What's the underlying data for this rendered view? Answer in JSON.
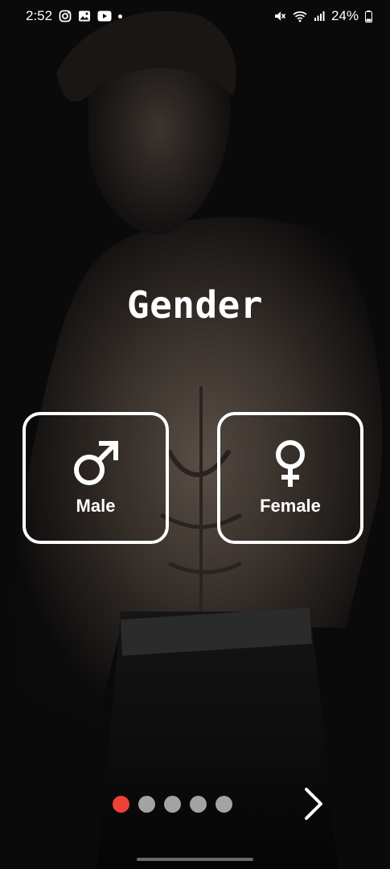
{
  "status_bar": {
    "time": "2:52",
    "battery": "24%",
    "left_icons": [
      "instagram-icon",
      "gallery-icon",
      "youtube-icon",
      "notification-dot"
    ],
    "right_icons": [
      "mute-icon",
      "wifi-icon",
      "signal-icon",
      "battery-icon"
    ]
  },
  "screen": {
    "title": "Gender"
  },
  "options": [
    {
      "label": "Male",
      "icon": "male-symbol-icon"
    },
    {
      "label": "Female",
      "icon": "female-symbol-icon"
    }
  ],
  "pager": {
    "total": 5,
    "current": 1,
    "active_color": "#ef4237",
    "inactive_color": "#a3a3a3"
  },
  "navigation": {
    "next_icon": "chevron-right-icon"
  },
  "colors": {
    "background": "#0b0b0b",
    "text": "#ffffff",
    "accent": "#ef4237"
  }
}
